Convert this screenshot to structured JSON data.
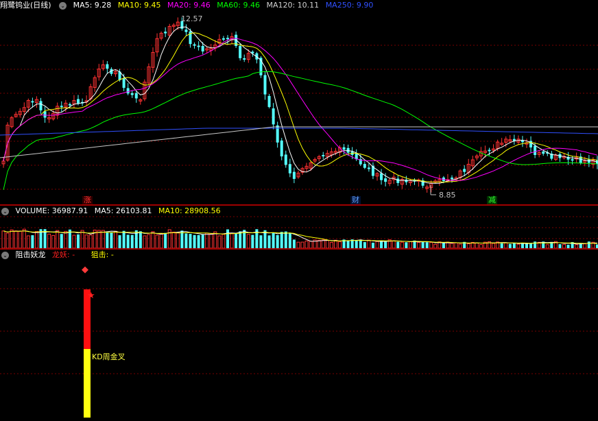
{
  "main": {
    "title": "翔鹭钨业(日线)",
    "ma": [
      {
        "label": "MA5: 9.28",
        "color": "#ffffff"
      },
      {
        "label": "MA10: 9.45",
        "color": "#ffff00"
      },
      {
        "label": "MA20: 9.46",
        "color": "#ff00ff"
      },
      {
        "label": "MA60: 9.46",
        "color": "#00ff00"
      },
      {
        "label": "MA120: 10.11",
        "color": "#d0d0d0"
      },
      {
        "label": "MA250: 9.90",
        "color": "#3050ff"
      }
    ],
    "high_label": "12.57",
    "low_label": "8.85",
    "markers": {
      "zhang": "涨",
      "cai": "财",
      "jian": "减"
    }
  },
  "volume": {
    "label_volume": "VOLUME: 36987.91",
    "label_ma5": "MA5: 26103.81",
    "label_ma10": "MA10: 28908.56"
  },
  "indicator": {
    "name": "阻击妖龙",
    "long_label": "龙妖: -",
    "snipe_label": "狙击: -",
    "kd_label": "KD周金叉"
  },
  "colors": {
    "up": "#ff3232",
    "down": "#54ffff",
    "grid": "#7a0000",
    "separator": "#a00000"
  }
}
